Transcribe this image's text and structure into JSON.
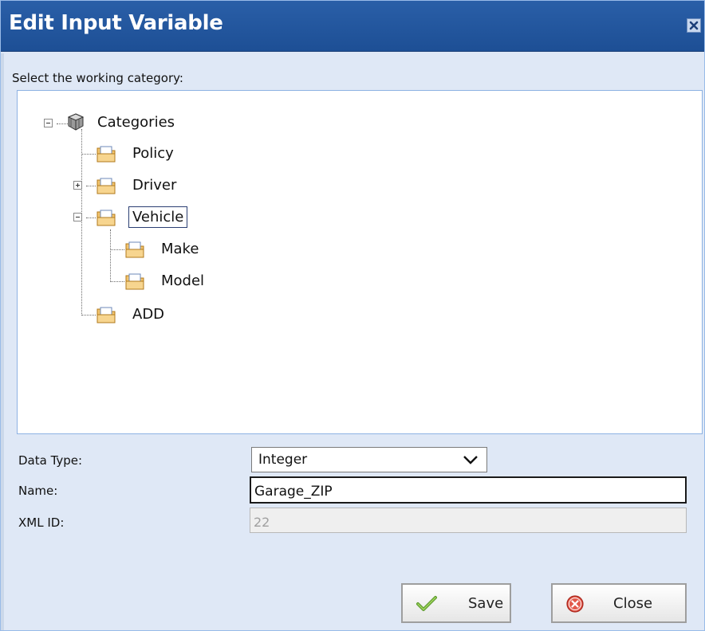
{
  "dialog": {
    "title": "Edit Input Variable"
  },
  "tree": {
    "prompt": "Select the working category:",
    "root": "Categories",
    "items": [
      {
        "label": "Policy"
      },
      {
        "label": "Driver"
      },
      {
        "label": "Vehicle"
      },
      {
        "label": "Make"
      },
      {
        "label": "Model"
      },
      {
        "label": "ADD"
      }
    ]
  },
  "form": {
    "data_type_label": "Data Type:",
    "data_type_value": "Integer",
    "name_label": "Name:",
    "name_value": "Garage_ZIP",
    "xml_id_label": "XML ID:",
    "xml_id_value": "22"
  },
  "buttons": {
    "save": "Save",
    "close": "Close"
  },
  "icons": {
    "close_window": "close-icon",
    "root": "cube-stack-icon",
    "folder": "folder-icon",
    "save": "checkmark-icon",
    "close": "cancel-circle-icon",
    "dropdown": "chevron-down-icon"
  },
  "colors": {
    "titlebar": "#2a5fa8",
    "panel_bg": "#dfe8f6",
    "tree_border": "#8db2e3"
  }
}
